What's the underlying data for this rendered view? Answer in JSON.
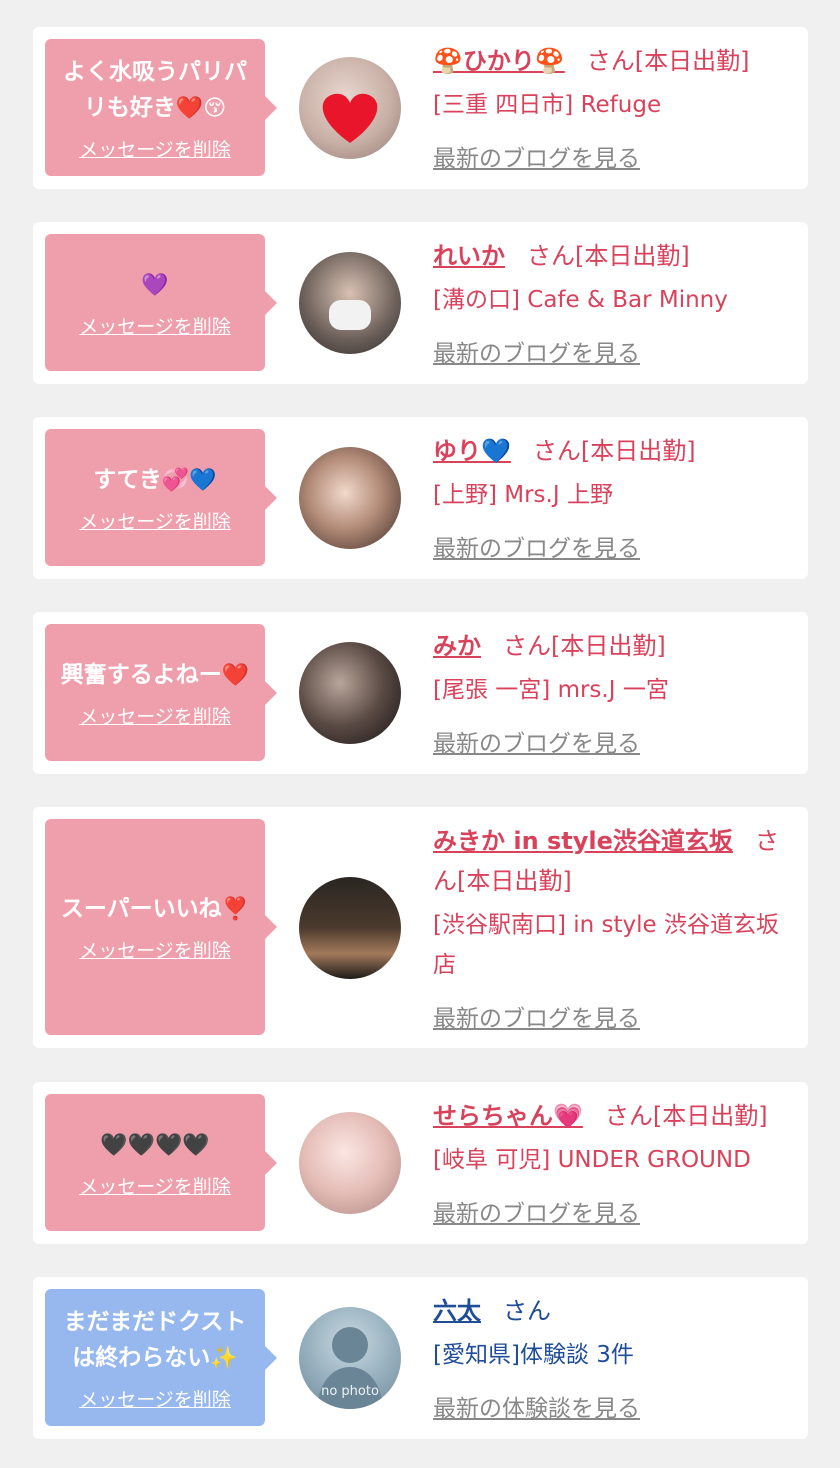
{
  "common": {
    "delete_label": "メッセージを削除",
    "san": "さん"
  },
  "cards": [
    {
      "message": "よく水吸うパリパリも好き",
      "message_emojis": "❤️😚",
      "name": "🍄ひかり🍄",
      "san": "さん[本日出勤]",
      "shop": "[三重 四日市] Refuge",
      "link": "最新のブログを見る"
    },
    {
      "message": "",
      "message_emojis": "💜",
      "name": "れいか",
      "san": "さん[本日出勤]",
      "shop": "[溝の口] Cafe & Bar Minny",
      "link": "最新のブログを見る"
    },
    {
      "message": "すてき",
      "message_emojis": "💞💙",
      "name": "ゆり💙",
      "san": "さん[本日出勤]",
      "shop": "[上野] Mrs.J 上野",
      "link": "最新のブログを見る"
    },
    {
      "message": "興奮するよねー",
      "message_emojis": "❤️",
      "name": "みか",
      "san": "さん[本日出勤]",
      "shop": "[尾張 一宮] mrs.J 一宮",
      "link": "最新のブログを見る"
    },
    {
      "message": "スーパーいいね",
      "message_emojis": "❣️",
      "name": "みきか in style渋谷道玄坂",
      "san": "さん[本日出勤]",
      "shop": "[渋谷駅南口] in style 渋谷道玄坂店",
      "link": "最新のブログを見る"
    },
    {
      "message": "",
      "message_emojis": "🖤🖤🖤🖤",
      "name": "せらちゃん💗",
      "san": "さん[本日出勤]",
      "shop": "[岐阜 可児] UNDER GROUND",
      "link": "最新のブログを見る"
    },
    {
      "message": "まだまだドクストは終わらない",
      "message_emojis": "✨",
      "name": "六太",
      "san": "さん",
      "shop": "[愛知県]体験談 3件",
      "link": "最新の体験談を見る",
      "avatar_text": "no photo"
    }
  ],
  "colors": {
    "pink_bubble": "#ef9fab",
    "blue_bubble": "#96b8ee",
    "pink_text": "#d9425b",
    "blue_text": "#1f4d98"
  }
}
